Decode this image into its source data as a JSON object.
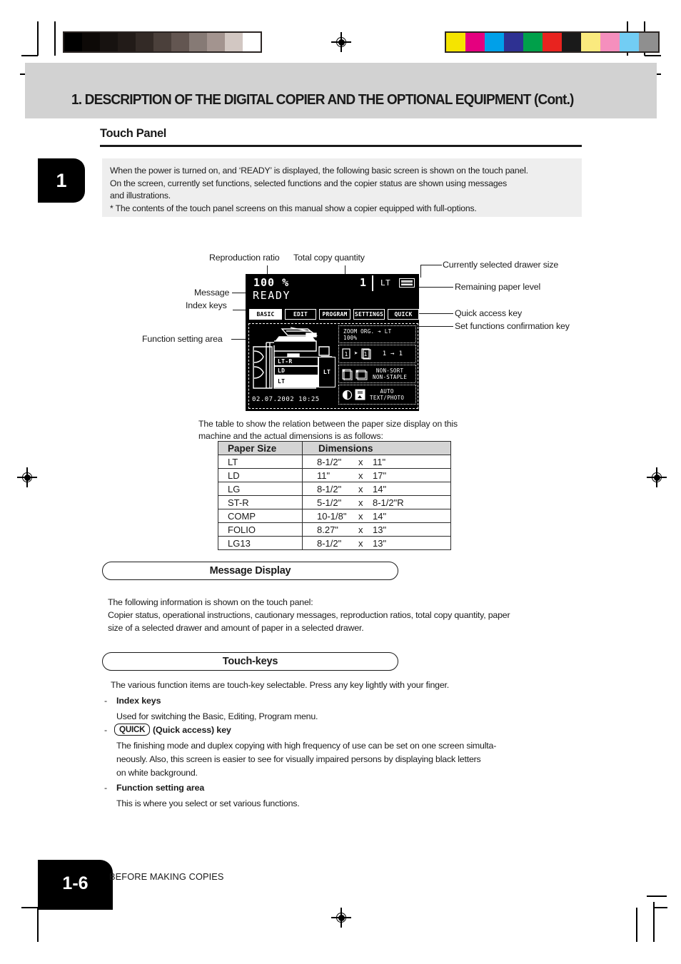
{
  "header": {
    "chapter_title": "1. DESCRIPTION OF THE DIGITAL COPIER AND THE OPTIONAL EQUIPMENT (Cont.)",
    "chapter_tab_number": "1"
  },
  "section": {
    "heading": "Touch Panel",
    "intro_lines": [
      "When the power is turned on, and ‘READY’ is displayed, the following basic screen is shown on the touch panel.",
      "On the screen, currently set functions, selected functions and the copier status are shown using messages",
      "and illustrations.",
      "* The contents of the touch panel screens on this manual show a copier equipped with full-options."
    ]
  },
  "callouts": {
    "reproduction_ratio": "Reproduction ratio",
    "total_copy_quantity": "Total copy quantity",
    "currently_selected_drawer_size": "Currently selected drawer size",
    "remaining_paper_level": "Remaining paper level",
    "message": "Message",
    "index_keys": "Index keys",
    "quick_access_key": "Quick access key",
    "set_functions_confirmation_key": "Set functions confirmation key",
    "function_setting_area": "Function setting area"
  },
  "lcd": {
    "ratio": "100  %",
    "quantity": "1",
    "drawer_size": "LT",
    "message": "READY",
    "index_keys": [
      {
        "label": "BASIC",
        "selected": true
      },
      {
        "label": "EDIT",
        "selected": false
      },
      {
        "label": "PROGRAM",
        "selected": false
      },
      {
        "label": "SETTINGS",
        "selected": false
      },
      {
        "label": "QUICK",
        "selected": false
      }
    ],
    "clock": "02.07.2002 10:25",
    "drawers": [
      {
        "label": "LT-R",
        "selected": false
      },
      {
        "label": "LD",
        "selected": false
      },
      {
        "label": "LT",
        "selected": true
      }
    ],
    "bypass_label": "LT",
    "function_keys": [
      {
        "line1": "ZOOM  ORG. ➔ LT",
        "line2": "100%"
      },
      {
        "line1": "1 → 1",
        "line2": ""
      },
      {
        "line1": "NON-SORT",
        "line2": "NON-STAPLE"
      },
      {
        "line1": "AUTO",
        "line2": "TEXT/PHOTO"
      }
    ]
  },
  "table_intro": "The table to show the relation between the paper size display on this machine and the actual dimensions is as follows:",
  "paper_table": {
    "columns": [
      "Paper  Size",
      "Dimensions"
    ],
    "rows": [
      {
        "name": "LT",
        "a": "8-1/2\"",
        "x": "x",
        "b": "11\""
      },
      {
        "name": "LD",
        "a": "11\"",
        "x": "x",
        "b": "17\""
      },
      {
        "name": "LG",
        "a": "8-1/2\"",
        "x": "x",
        "b": "14\""
      },
      {
        "name": "ST-R",
        "a": "5-1/2\"",
        "x": "x",
        "b": "8-1/2\"R"
      },
      {
        "name": "COMP",
        "a": "10-1/8\"",
        "x": "x",
        "b": "14\""
      },
      {
        "name": "FOLIO",
        "a": "8.27\"",
        "x": "x",
        "b": "13\""
      },
      {
        "name": "LG13",
        "a": "8-1/2\"",
        "x": "x",
        "b": "13\""
      }
    ]
  },
  "message_display": {
    "pill": "Message Display",
    "line1": "The following information is shown on the touch panel:",
    "line2": "Copier status, operational instructions, cautionary messages, reproduction ratios, total copy quantity, paper",
    "line3": "size of a selected drawer and amount of paper in a selected drawer."
  },
  "touch_keys": {
    "pill": "Touch-keys",
    "intro": "The various function items are touch-key selectable. Press any key lightly with your finger.",
    "dash": "-",
    "item1_head": "Index keys",
    "item1_body": "Used for switching the Basic, Editing, Program menu.",
    "item2_chip": "QUICK",
    "item2_head": "(Quick access) key",
    "item2_line1": "The finishing mode and duplex copying with high frequency of use can be set on one screen simulta-",
    "item2_line2": "neously.  Also, this screen is easier to see for visually impaired persons by displaying black letters",
    "item2_line3": "on white background.",
    "item3_head": "Function setting area",
    "item3_body": "This is where you select or set various functions."
  },
  "footer": {
    "page_number": "1-6",
    "running_head": "BEFORE MAKING COPIES"
  },
  "press_marks": {
    "grayscale_swatches": [
      "#000000",
      "#0d0907",
      "#171210",
      "#221b18",
      "#332a26",
      "#4b403b",
      "#635651",
      "#867a75",
      "#a3948f",
      "#d2c7c2",
      "#ffffff"
    ],
    "color_swatches": [
      "#f5e400",
      "#e5007f",
      "#00a0e9",
      "#2e3192",
      "#00a04a",
      "#e8231f",
      "#1a1a1a",
      "#faea7e",
      "#f58fbd",
      "#72cdf4",
      "#8f8f8f"
    ]
  },
  "colors": {
    "header_band": "#d2d2d2",
    "intro_box": "#eeeeee",
    "table_header": "#d4d4d4",
    "ink": "#1a1a1a"
  }
}
